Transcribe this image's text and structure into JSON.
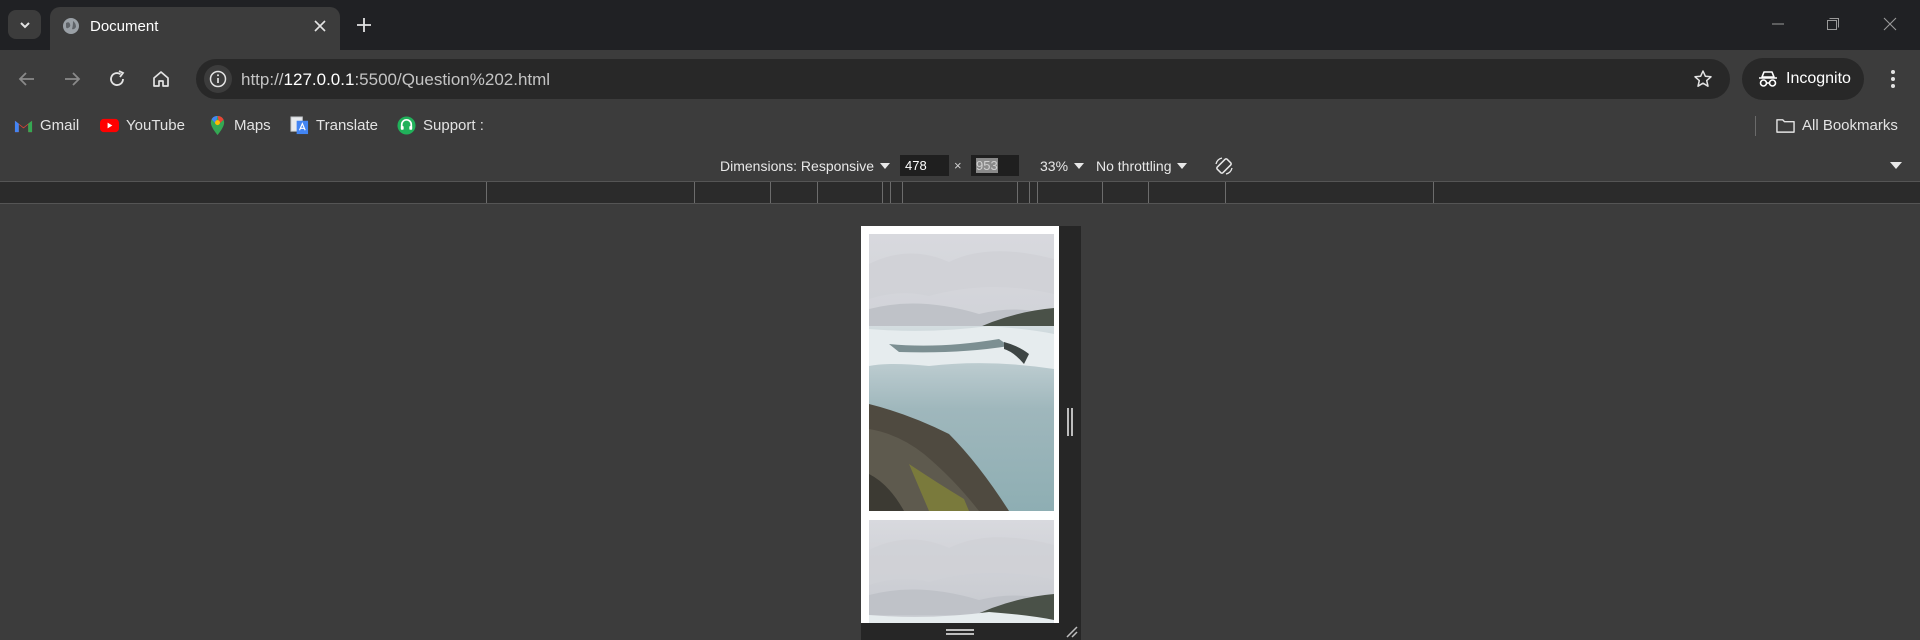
{
  "browser": {
    "tab": {
      "title": "Document",
      "favicon": "globe-icon"
    },
    "omnibox": {
      "url_prefix": "http://",
      "url_host": "127.0.0.1",
      "url_rest": ":5500/Question%202.html"
    },
    "incognito_label": "Incognito",
    "bookmarks": [
      {
        "label": "Gmail",
        "icon": "gmail-icon"
      },
      {
        "label": "YouTube",
        "icon": "youtube-icon"
      },
      {
        "label": "Maps",
        "icon": "maps-icon"
      },
      {
        "label": "Translate",
        "icon": "translate-icon"
      },
      {
        "label": "Support :",
        "icon": "support-icon"
      }
    ],
    "all_bookmarks_label": "All Bookmarks"
  },
  "devtools": {
    "dimensions_label": "Dimensions: Responsive",
    "width": "478",
    "height": "953",
    "times": "×",
    "zoom": "33%",
    "throttling": "No throttling"
  },
  "page": {
    "images": [
      {
        "alt": "waterfall-photo-1"
      },
      {
        "alt": "waterfall-photo-2"
      }
    ]
  },
  "colors": {
    "tabstrip_bg": "#202124",
    "toolbar_bg": "#3c3c3c",
    "omnibox_bg": "#282828",
    "device_frame": "#262626"
  }
}
